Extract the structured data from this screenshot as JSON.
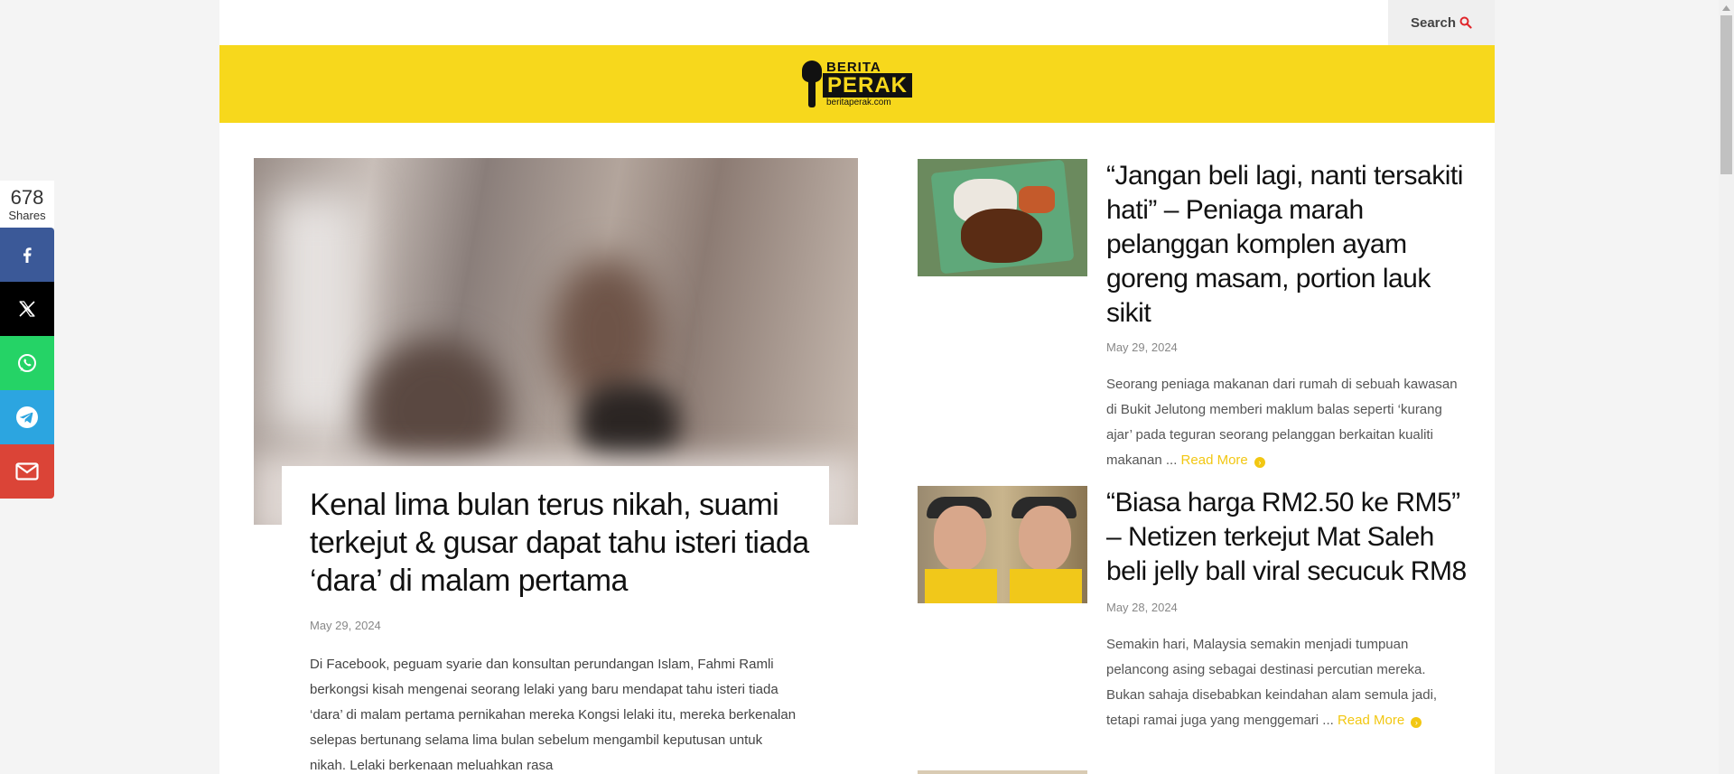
{
  "topbar": {
    "search_label": "Search"
  },
  "logo": {
    "line1": "BERITA",
    "line2": "PERAK",
    "line3": "beritaperak.com"
  },
  "share": {
    "count": "678",
    "count_label": "Shares"
  },
  "featured": {
    "title": "Kenal lima bulan terus nikah, suami terkejut & gusar dapat tahu isteri tiada ‘dara’ di malam pertama",
    "date": "May 29, 2024",
    "excerpt": "  Di Facebook, peguam syarie dan konsultan perundangan Islam, Fahmi Ramli berkongsi kisah mengenai seorang lelaki yang baru mendapat tahu isteri tiada ‘dara’ di malam pertama pernikahan mereka Kongsi lelaki itu, mereka berkenalan selepas bertunang selama lima bulan sebelum mengambil keputusan untuk nikah. Lelaki berkenaan meluahkan rasa"
  },
  "side_articles": [
    {
      "title": "“Jangan beli lagi, nanti tersakiti hati” – Peniaga marah pelanggan komplen ayam goreng masam, portion lauk sikit",
      "date": "May 29, 2024",
      "excerpt": "  Seorang peniaga makanan dari rumah di sebuah kawasan di Bukit Jelutong memberi maklum balas seperti ‘kurang ajar’ pada teguran seorang pelanggan berkaitan kualiti makanan ... ",
      "read_more": "Read More"
    },
    {
      "title": "“Biasa harga RM2.50 ke RM5” – Netizen terkejut Mat Saleh beli jelly ball viral secucuk RM8",
      "date": "May 28, 2024",
      "excerpt": "  Semakin hari, Malaysia semakin menjadi tumpuan pelancong asing sebagai destinasi percutian mereka. Bukan sahaja disebabkan keindahan alam semula jadi, tetapi ramai juga yang menggemari ... ",
      "read_more": "Read More"
    }
  ],
  "colors": {
    "brand_yellow": "#f7d81c",
    "accent": "#f2c712",
    "facebook": "#3b5998",
    "x": "#000000",
    "whatsapp": "#25d366",
    "telegram": "#2ca5e0",
    "email": "#db4437"
  }
}
